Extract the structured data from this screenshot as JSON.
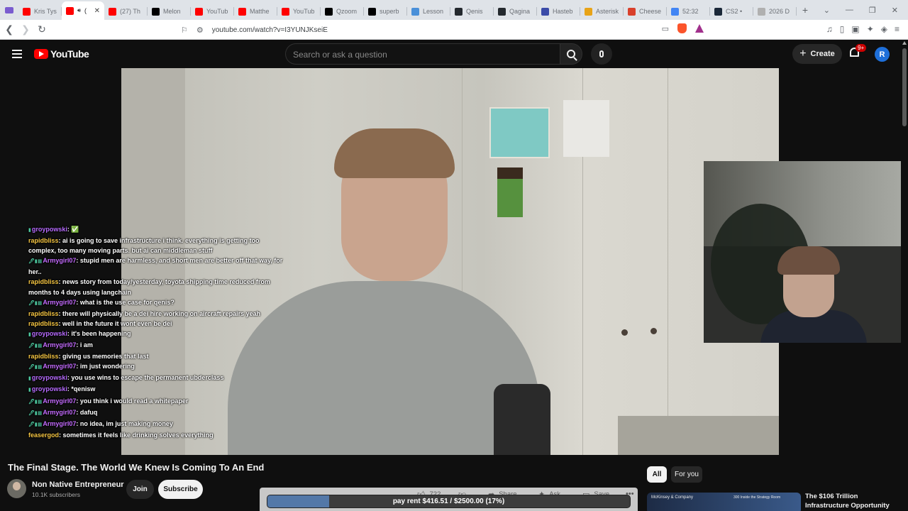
{
  "browser": {
    "tabs": [
      {
        "title": "Kris Tys",
        "favicon": "youtube-icon",
        "color": "#ff0000"
      },
      {
        "title": "(",
        "favicon": "youtube-icon",
        "color": "#ff0000",
        "active": true
      },
      {
        "title": "(27) Th",
        "favicon": "youtube-icon",
        "color": "#ff0000"
      },
      {
        "title": "Melon",
        "favicon": "x-icon",
        "color": "#000000"
      },
      {
        "title": "YouTub",
        "favicon": "youtube-icon",
        "color": "#ff0000"
      },
      {
        "title": "Matthe",
        "favicon": "youtube-icon",
        "color": "#ff0000"
      },
      {
        "title": "YouTub",
        "favicon": "youtube-icon",
        "color": "#ff0000"
      },
      {
        "title": "Qzoom",
        "favicon": "x-icon",
        "color": "#000000"
      },
      {
        "title": "superb",
        "favicon": "x-icon",
        "color": "#000000"
      },
      {
        "title": "Lesson",
        "favicon": "doc-icon",
        "color": "#4a90d9"
      },
      {
        "title": "Qenis",
        "favicon": "github-icon",
        "color": "#24292e"
      },
      {
        "title": "Qagina",
        "favicon": "github-icon",
        "color": "#24292e"
      },
      {
        "title": "Hasteb",
        "favicon": "hastebin-icon",
        "color": "#3b4ba8"
      },
      {
        "title": "Asterisk",
        "favicon": "asterisk-icon",
        "color": "#e8a317"
      },
      {
        "title": "Cheese",
        "favicon": "cheese-icon",
        "color": "#d9402b"
      },
      {
        "title": "52:32",
        "favicon": "google-icon",
        "color": "#4285f4"
      },
      {
        "title": "CS2 •",
        "favicon": "steam-icon",
        "color": "#1b2838"
      },
      {
        "title": "2026 D",
        "favicon": "page-icon",
        "color": "#b0b0b0"
      }
    ],
    "url": "youtube.com/watch?v=I3YUNJKseiE"
  },
  "youtube": {
    "logo_text": "YouTube",
    "search_placeholder": "Search or ask a question",
    "create_label": "Create",
    "notifications_badge": "9+",
    "avatar_letter": "R"
  },
  "chat": [
    {
      "user": "groypowski",
      "badges": "▮",
      "color": "#b76bff",
      "message": "✅"
    },
    {
      "user": "rapidbliss",
      "badges": "",
      "color": "#f5c542",
      "message": "ai is going to save infrastructure i think. everything is getting too complex, too many moving parts. but ai can middleman stuff"
    },
    {
      "user": "Armygirl07",
      "badges": "🖊▮▦",
      "color": "#c46bff",
      "message": "stupid men are harmless, and short men are better off that way, for her.."
    },
    {
      "user": "rapidbliss",
      "badges": "",
      "color": "#f5c542",
      "message": "news story from today/yesterday, toyota shipping time reduced from months to 4 days using langchain"
    },
    {
      "user": "Armygirl07",
      "badges": "🖊▮▦",
      "color": "#c46bff",
      "message": "what is the use case for qenis?"
    },
    {
      "user": "rapidbliss",
      "badges": "",
      "color": "#f5c542",
      "message": "there will physically be a dei hire working on aircraft repairs yeah"
    },
    {
      "user": "rapidbliss",
      "badges": "",
      "color": "#f5c542",
      "message": "well in the future it wont even be dei"
    },
    {
      "user": "groypowski",
      "badges": "▮",
      "color": "#b76bff",
      "message": "it's been happening"
    },
    {
      "user": "Armygirl07",
      "badges": "🖊▮▦",
      "color": "#c46bff",
      "message": "i am"
    },
    {
      "user": "rapidbliss",
      "badges": "",
      "color": "#f5c542",
      "message": "giving us memories that last"
    },
    {
      "user": "Armygirl07",
      "badges": "🖊▮▦",
      "color": "#c46bff",
      "message": "im just wondering"
    },
    {
      "user": "groypowski",
      "badges": "▮",
      "color": "#b76bff",
      "message": "you use wins to escape the permanent ubderclass"
    },
    {
      "user": "groypowski",
      "badges": "▮",
      "color": "#b76bff",
      "message": "*qenisw"
    },
    {
      "user": "Armygirl07",
      "badges": "🖊▮▦",
      "color": "#c46bff",
      "message": "you think i would read a whitepaper"
    },
    {
      "user": "Armygirl07",
      "badges": "🖊▮▦",
      "color": "#c46bff",
      "message": "dafuq"
    },
    {
      "user": "Armygirl07",
      "badges": "🖊▮▦",
      "color": "#c46bff",
      "message": "no idea, im just making money"
    },
    {
      "user": "feasergod",
      "badges": "",
      "color": "#f5c542",
      "message": "sometimes it feels like drinking solves everything"
    }
  ],
  "video": {
    "title": "The Final Stage. The World We Knew Is Coming To An End",
    "channel_name": "Non Native Entrepreneur",
    "subscribers": "10.1K subscribers",
    "join_label": "Join",
    "subscribe_label": "Subscribe",
    "like_count": "722",
    "share_label": "Share",
    "ask_label": "Ask",
    "save_label": "Save"
  },
  "goal_bar": {
    "text": "pay rent $416.51 / $2500.00 (17%)",
    "fraction": 0.17,
    "color": "#5378a8"
  },
  "sidebar": {
    "chips": [
      "All",
      "For you"
    ],
    "recommendation": {
      "title": "The $106 Trillion Infrastructure Opportunity",
      "thumb_left": "McKinsey & Company",
      "thumb_right": "300 Inside the Strategy Room"
    }
  }
}
